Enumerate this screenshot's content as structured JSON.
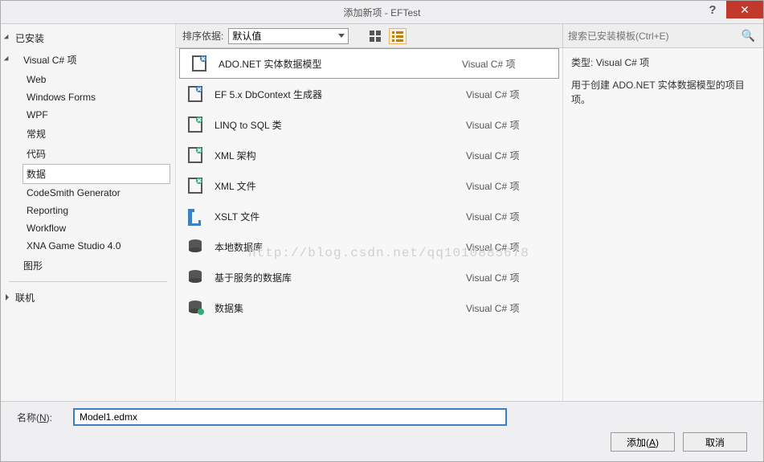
{
  "window": {
    "title": "添加新项 - EFTest"
  },
  "tree": {
    "root": "已安装",
    "csharp": "Visual C# 项",
    "items": [
      "Web",
      "Windows Forms",
      "WPF",
      "常规",
      "代码",
      "数据",
      "CodeSmith Generator",
      "Reporting",
      "Workflow",
      "XNA Game Studio 4.0"
    ],
    "selected_index": 5,
    "extra": "图形",
    "online": "联机"
  },
  "toolbar": {
    "sort_label": "排序依据:",
    "sort_value": "默认值"
  },
  "search": {
    "placeholder": "搜索已安装模板(Ctrl+E)"
  },
  "templates": [
    {
      "name": "ADO.NET 实体数据模型",
      "lang": "Visual C# 项",
      "icon": "edm"
    },
    {
      "name": "EF 5.x DbContext 生成器",
      "lang": "Visual C# 项",
      "icon": "ef"
    },
    {
      "name": "LINQ to SQL 类",
      "lang": "Visual C# 项",
      "icon": "linq"
    },
    {
      "name": "XML 架构",
      "lang": "Visual C# 项",
      "icon": "xsd"
    },
    {
      "name": "XML 文件",
      "lang": "Visual C# 项",
      "icon": "xml"
    },
    {
      "name": "XSLT 文件",
      "lang": "Visual C# 项",
      "icon": "xslt"
    },
    {
      "name": "本地数据库",
      "lang": "Visual C# 项",
      "icon": "db"
    },
    {
      "name": "基于服务的数据库",
      "lang": "Visual C# 项",
      "icon": "db"
    },
    {
      "name": "数据集",
      "lang": "Visual C# 项",
      "icon": "ds"
    }
  ],
  "selected_template": 0,
  "watermark": "http://blog.csdn.net/qq1010885678",
  "detail": {
    "type_label": "类型:",
    "type_value": "Visual C# 项",
    "description": "用于创建 ADO.NET 实体数据模型的项目项。"
  },
  "nameField": {
    "label": "名称(",
    "hotkey": "N",
    "label2": "):",
    "value": "Model1.edmx"
  },
  "buttons": {
    "ok": "添加(",
    "ok_hotkey": "A",
    "ok2": ")",
    "cancel": "取消"
  }
}
